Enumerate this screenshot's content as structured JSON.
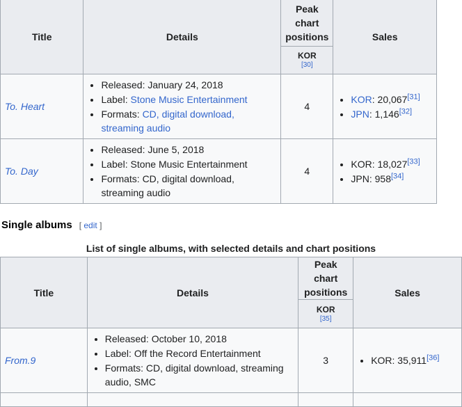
{
  "table1": {
    "headers": {
      "title": "Title",
      "details": "Details",
      "peak": "Peak chart positions",
      "kor": "KOR",
      "kor_ref": "[30]",
      "sales": "Sales"
    },
    "rows": [
      {
        "title": "To. Heart",
        "released": "Released: January 24, 2018",
        "label_prefix": "Label: ",
        "label": "Stone Music Entertainment",
        "formats_prefix": "Formats: ",
        "formats": "CD, digital download, streaming audio",
        "peak": "4",
        "sales": [
          {
            "country": "KOR",
            "value": ": 20,067",
            "ref": "[31]"
          },
          {
            "country": "JPN",
            "value": ": 1,146",
            "ref": "[32]"
          }
        ]
      },
      {
        "title": "To. Day",
        "released": "Released: June 5, 2018",
        "label_prefix": "Label: ",
        "label": "Stone Music Entertainment",
        "formats_prefix": "Formats: ",
        "formats": "CD, digital download, streaming audio",
        "peak": "4",
        "sales": [
          {
            "country": "KOR",
            "value": ": 18,027",
            "ref": "[33]"
          },
          {
            "country": "JPN",
            "value": ": 958",
            "ref": "[34]"
          }
        ]
      }
    ]
  },
  "section": {
    "heading": "Single albums",
    "edit_open": "[ ",
    "edit_label": "edit",
    "edit_close": " ]"
  },
  "table2": {
    "caption": "List of single albums, with selected details and chart positions",
    "headers": {
      "title": "Title",
      "details": "Details",
      "peak": "Peak chart positions",
      "kor": "KOR",
      "kor_ref": "[35]",
      "sales": "Sales"
    },
    "rows": [
      {
        "title": "From.9",
        "released": "Released: October 10, 2018",
        "label_prefix": "Label: ",
        "label": "Off the Record Entertainment",
        "formats_prefix": "Formats: ",
        "formats": "CD, digital download, streaming audio, SMC",
        "peak": "3",
        "sales": [
          {
            "country": "KOR",
            "value": ": 35,911",
            "ref": "[36]"
          }
        ]
      }
    ]
  }
}
